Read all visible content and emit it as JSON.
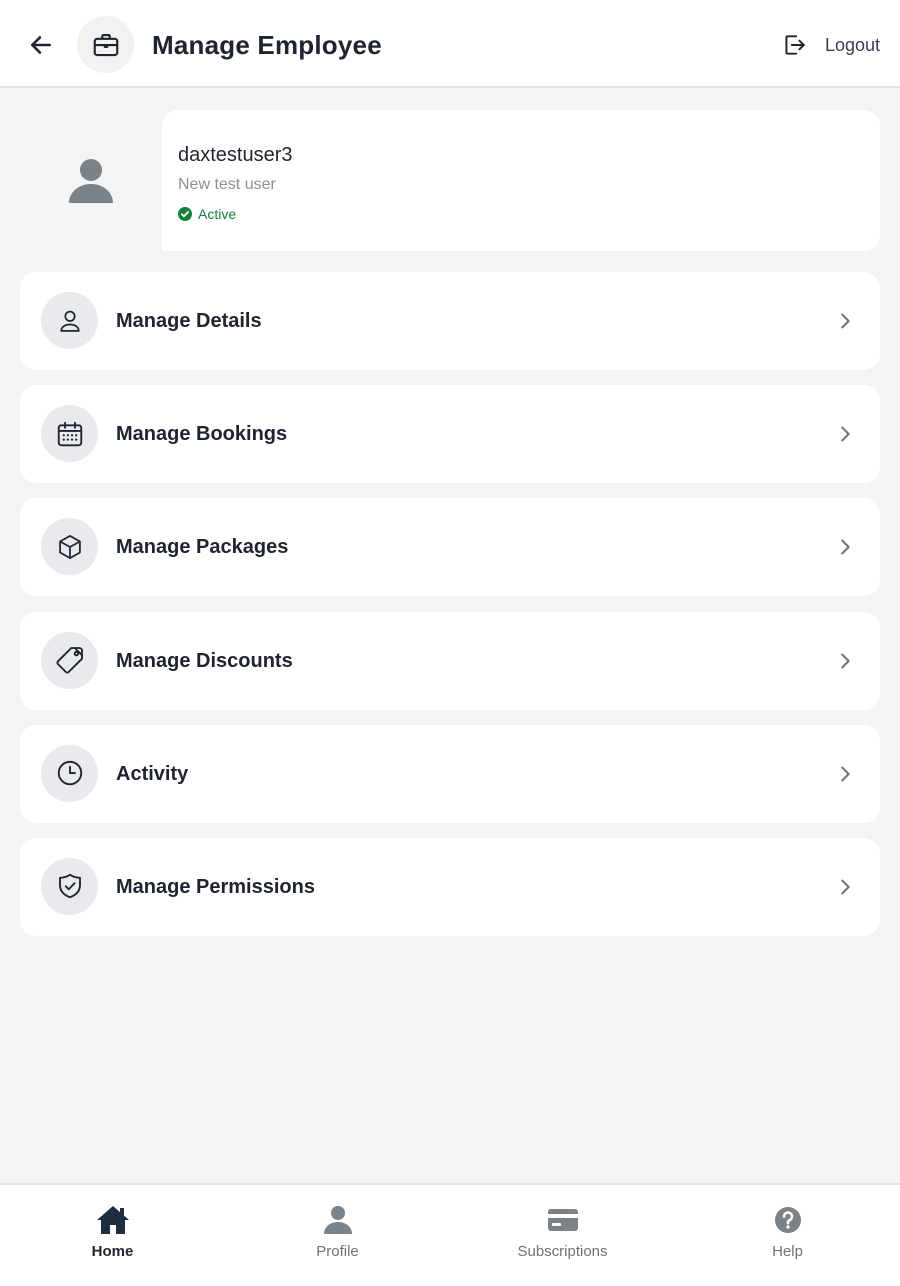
{
  "header": {
    "title": "Manage Employee",
    "back_icon": "arrow-left-icon",
    "title_icon": "briefcase-icon",
    "logout_label": "Logout",
    "logout_icon": "logout-icon"
  },
  "profile": {
    "name": "daxtestuser3",
    "description": "New test user",
    "status": "Active",
    "status_color": "#15803d",
    "avatar_icon": "user-avatar-icon"
  },
  "menu": {
    "items": [
      {
        "label": "Manage Details",
        "icon": "user-icon"
      },
      {
        "label": "Manage Bookings",
        "icon": "calendar-icon"
      },
      {
        "label": "Manage Packages",
        "icon": "package-icon"
      },
      {
        "label": "Manage Discounts",
        "icon": "tag-icon"
      },
      {
        "label": "Activity",
        "icon": "clock-icon"
      },
      {
        "label": "Manage Permissions",
        "icon": "shield-check-icon"
      }
    ]
  },
  "bottom_nav": {
    "items": [
      {
        "label": "Home",
        "icon": "home-icon",
        "active": true
      },
      {
        "label": "Profile",
        "icon": "profile-icon",
        "active": false
      },
      {
        "label": "Subscriptions",
        "icon": "card-icon",
        "active": false
      },
      {
        "label": "Help",
        "icon": "help-icon",
        "active": false
      }
    ]
  },
  "colors": {
    "background": "#f3f4f6",
    "card": "#ffffff",
    "text_primary": "#1e2530",
    "text_muted": "#6b7280",
    "icon_gray": "#7b8288",
    "active_green": "#15803d"
  }
}
